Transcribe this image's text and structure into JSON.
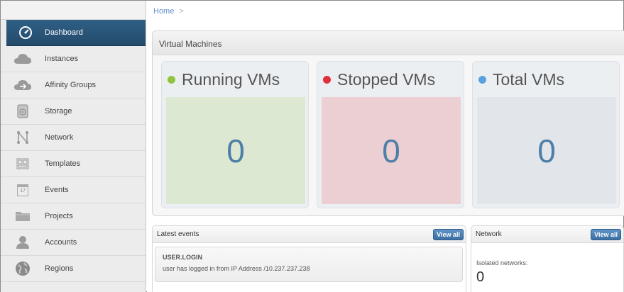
{
  "breadcrumb": {
    "home": "Home",
    "separator": ">"
  },
  "sidebar": {
    "items": [
      {
        "label": "Dashboard",
        "icon": "dashboard-icon"
      },
      {
        "label": "Instances",
        "icon": "cloud-icon"
      },
      {
        "label": "Affinity Groups",
        "icon": "affinity-cloud-icon"
      },
      {
        "label": "Storage",
        "icon": "disk-icon"
      },
      {
        "label": "Network",
        "icon": "network-icon"
      },
      {
        "label": "Templates",
        "icon": "template-icon"
      },
      {
        "label": "Events",
        "icon": "calendar-icon"
      },
      {
        "label": "Projects",
        "icon": "folder-icon"
      },
      {
        "label": "Accounts",
        "icon": "user-icon"
      },
      {
        "label": "Regions",
        "icon": "globe-icon"
      }
    ],
    "events_icon_text": "17"
  },
  "vm": {
    "title": "Virtual Machines",
    "running": {
      "label": "Running VMs",
      "value": "0",
      "color": "#8fc43e",
      "box": "#dde8d3"
    },
    "stopped": {
      "label": "Stopped VMs",
      "value": "0",
      "color": "#e0303c",
      "box": "#ebcfd3"
    },
    "total": {
      "label": "Total VMs",
      "value": "0",
      "color": "#5aa0e0",
      "box": "#e2e6ea"
    }
  },
  "events": {
    "title": "Latest events",
    "view_all": "View all",
    "items": [
      {
        "title": "USER.LOGIN",
        "desc": "user has logged in from IP Address /10.237.237.238"
      }
    ]
  },
  "network": {
    "title": "Network",
    "view_all": "View all",
    "isolated_label": "Isolated networks:",
    "isolated_value": "0"
  }
}
